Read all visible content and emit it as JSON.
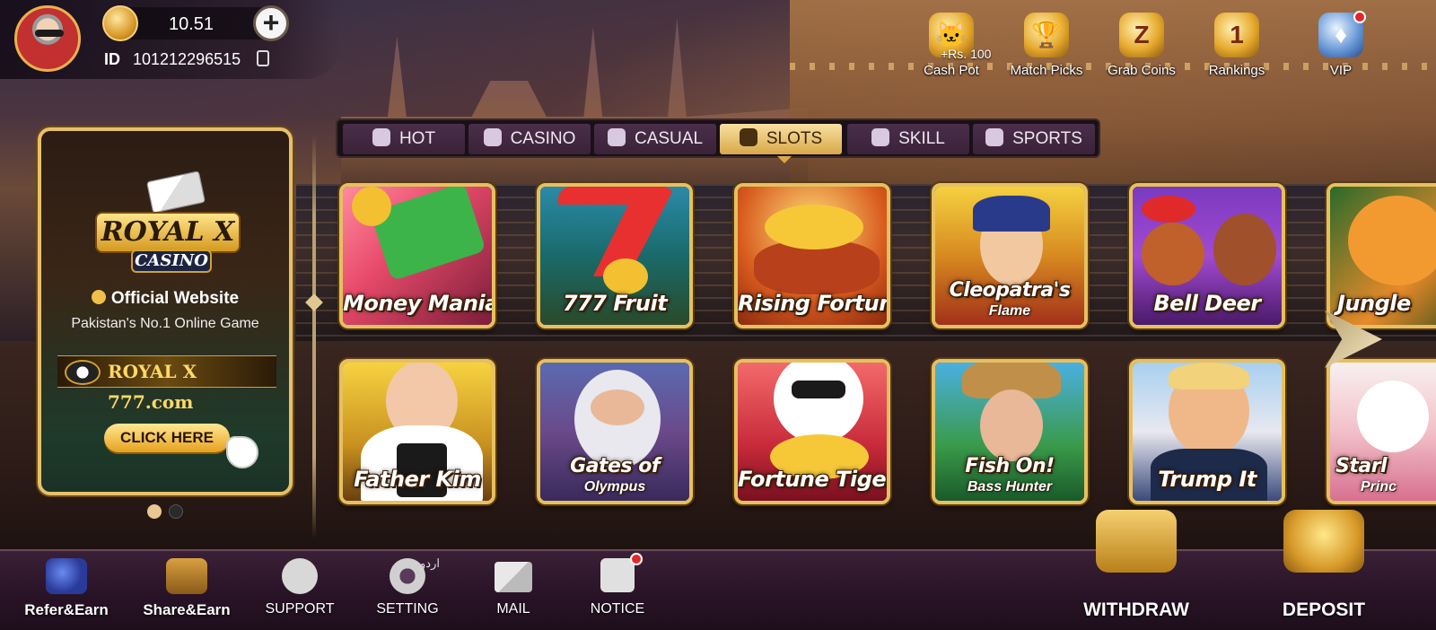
{
  "profile": {
    "balance": "10.51",
    "id_label": "ID",
    "id_value": "101212296515"
  },
  "top_icons": [
    {
      "name": "cash-pot",
      "label": "Cash Pot",
      "badge": "+Rs. 100",
      "icon": "lucky-cat-icon"
    },
    {
      "name": "match-picks",
      "label": "Match Picks",
      "icon": "trophy-icon"
    },
    {
      "name": "grab-coins",
      "label": "Grab Coins",
      "icon": "coin-z-icon"
    },
    {
      "name": "rankings",
      "label": "Rankings",
      "icon": "podium-icon"
    },
    {
      "name": "vip",
      "label": "VIP",
      "icon": "vip-badge-icon"
    }
  ],
  "banner": {
    "logo_main": "ROYAL X",
    "logo_sub": "CASINO",
    "official": "Official Website",
    "tagline": "Pakistan's No.1 Online Game",
    "site": "ROYAL X 777.com",
    "cta": "CLICK HERE"
  },
  "tabs": [
    {
      "label": "HOT",
      "icon": "flame-icon"
    },
    {
      "label": "CASINO",
      "icon": "dealer-icon"
    },
    {
      "label": "CASUAL",
      "icon": "gamepad-icon"
    },
    {
      "label": "SLOTS",
      "icon": "slot-machine-icon",
      "active": true
    },
    {
      "label": "SKILL",
      "icon": "swords-icon"
    },
    {
      "label": "SPORTS",
      "icon": "soccer-ball-icon"
    }
  ],
  "games": [
    {
      "title": "Money Mania",
      "sub": ""
    },
    {
      "title": "777 Fruit",
      "sub": ""
    },
    {
      "title": "Rising Fortunes",
      "sub": ""
    },
    {
      "title": "Cleopatra's",
      "sub": "Flame"
    },
    {
      "title": "Bell Deer",
      "sub": ""
    },
    {
      "title": "Jungle",
      "sub": ""
    },
    {
      "title": "Father Kim",
      "sub": ""
    },
    {
      "title": "Gates of",
      "sub": "Olympus"
    },
    {
      "title": "Fortune Tiger",
      "sub": ""
    },
    {
      "title": "Fish On!",
      "sub": "Bass Hunter"
    },
    {
      "title": "Trump It",
      "sub": ""
    },
    {
      "title": "Starl",
      "sub": "Princ"
    }
  ],
  "bottom_nav": [
    {
      "label": "Refer&Earn",
      "icon": "refer-phone-icon"
    },
    {
      "label": "Share&Earn",
      "icon": "share-chest-icon"
    },
    {
      "label": "SUPPORT",
      "icon": "chat-bubble-icon"
    },
    {
      "label": "SETTING",
      "icon": "gear-icon",
      "badge": "اردو"
    },
    {
      "label": "MAIL",
      "icon": "envelope-icon"
    },
    {
      "label": "NOTICE",
      "icon": "notice-doc-icon"
    }
  ],
  "actions": {
    "withdraw": "WITHDRAW",
    "deposit": "DEPOSIT"
  },
  "colors": {
    "gold": "#e6c060",
    "tab_bg": "#3a2238",
    "tab_active": "#d9a848",
    "notice_dot": "#e02a2a"
  }
}
